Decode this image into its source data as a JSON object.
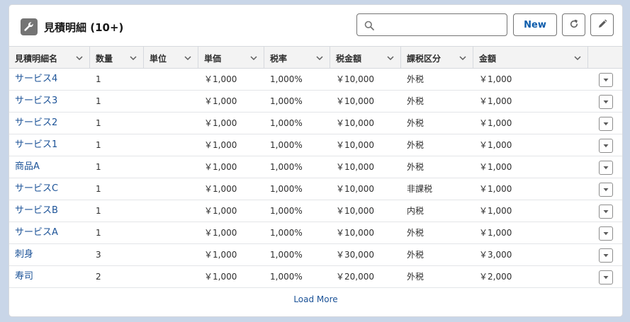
{
  "card": {
    "title": "見積明細 (10+)",
    "icon": "wrench-icon"
  },
  "toolbar": {
    "search_placeholder": "",
    "search_value": "",
    "new_label": "New",
    "refresh_icon": "refresh-icon",
    "edit_icon": "pencil-icon"
  },
  "columns": [
    {
      "key": "name",
      "label": "見積明細名"
    },
    {
      "key": "qty",
      "label": "数量"
    },
    {
      "key": "unit",
      "label": "単位"
    },
    {
      "key": "price",
      "label": "単価"
    },
    {
      "key": "taxrate",
      "label": "税率"
    },
    {
      "key": "tax",
      "label": "税金額"
    },
    {
      "key": "taxclass",
      "label": "課税区分"
    },
    {
      "key": "amount",
      "label": "金額"
    }
  ],
  "rows": [
    {
      "name": "サービス4",
      "qty": "1",
      "unit": "",
      "price": "￥1,000",
      "taxrate": "1,000%",
      "tax": "￥10,000",
      "taxclass": "外税",
      "amount": "￥1,000"
    },
    {
      "name": "サービス3",
      "qty": "1",
      "unit": "",
      "price": "￥1,000",
      "taxrate": "1,000%",
      "tax": "￥10,000",
      "taxclass": "外税",
      "amount": "￥1,000"
    },
    {
      "name": "サービス2",
      "qty": "1",
      "unit": "",
      "price": "￥1,000",
      "taxrate": "1,000%",
      "tax": "￥10,000",
      "taxclass": "外税",
      "amount": "￥1,000"
    },
    {
      "name": "サービス1",
      "qty": "1",
      "unit": "",
      "price": "￥1,000",
      "taxrate": "1,000%",
      "tax": "￥10,000",
      "taxclass": "外税",
      "amount": "￥1,000"
    },
    {
      "name": "商品A",
      "qty": "1",
      "unit": "",
      "price": "￥1,000",
      "taxrate": "1,000%",
      "tax": "￥10,000",
      "taxclass": "外税",
      "amount": "￥1,000"
    },
    {
      "name": "サービスC",
      "qty": "1",
      "unit": "",
      "price": "￥1,000",
      "taxrate": "1,000%",
      "tax": "￥10,000",
      "taxclass": "非課税",
      "amount": "￥1,000"
    },
    {
      "name": "サービスB",
      "qty": "1",
      "unit": "",
      "price": "￥1,000",
      "taxrate": "1,000%",
      "tax": "￥10,000",
      "taxclass": "内税",
      "amount": "￥1,000"
    },
    {
      "name": "サービスA",
      "qty": "1",
      "unit": "",
      "price": "￥1,000",
      "taxrate": "1,000%",
      "tax": "￥10,000",
      "taxclass": "外税",
      "amount": "￥1,000"
    },
    {
      "name": "刺身",
      "qty": "3",
      "unit": "",
      "price": "￥1,000",
      "taxrate": "1,000%",
      "tax": "￥30,000",
      "taxclass": "外税",
      "amount": "￥3,000"
    },
    {
      "name": "寿司",
      "qty": "2",
      "unit": "",
      "price": "￥1,000",
      "taxrate": "1,000%",
      "tax": "￥20,000",
      "taxclass": "外税",
      "amount": "￥2,000"
    }
  ],
  "footer": {
    "load_more_label": "Load More"
  }
}
